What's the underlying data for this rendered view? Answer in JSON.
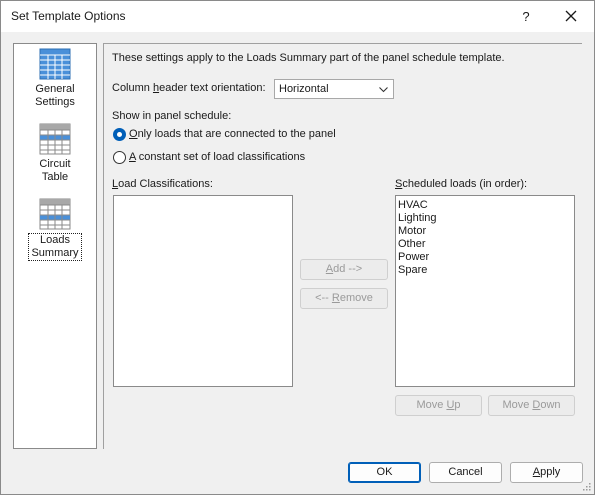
{
  "window": {
    "title": "Set Template Options",
    "help_label": "?",
    "close_icon": "close-icon"
  },
  "nav": {
    "items": [
      {
        "label_line1": "General",
        "label_line2": "Settings",
        "icon": "general-settings-table-icon",
        "selected": false
      },
      {
        "label_line1": "Circuit",
        "label_line2": "Table",
        "icon": "circuit-table-icon",
        "selected": false
      },
      {
        "label_line1": "Loads",
        "label_line2": "Summary",
        "icon": "loads-summary-table-icon",
        "selected": true
      }
    ]
  },
  "content": {
    "description": "These settings apply to the Loads Summary part of the panel schedule template.",
    "orientation_label": "Column header text orientation:",
    "orientation_value": "Horizontal",
    "show_label": "Show in panel schedule:",
    "radio_options": [
      {
        "label": "Only loads that are connected to the panel",
        "checked": true
      },
      {
        "label": "A constant set of load classifications",
        "checked": false
      }
    ],
    "load_classifications_label": "Load Classifications:",
    "load_classifications": [],
    "scheduled_loads_label": "Scheduled loads (in order):",
    "scheduled_loads": [
      "HVAC",
      "Lighting",
      "Motor",
      "Other",
      "Power",
      "Spare"
    ],
    "add_button": "Add -->",
    "remove_button": "<-- Remove",
    "move_up_button": "Move Up",
    "move_down_button": "Move Down"
  },
  "footer": {
    "ok_label": "OK",
    "cancel_label": "Cancel",
    "apply_label": "Apply"
  },
  "colors": {
    "accent": "#005fb8",
    "icon_blue": "#4a90d9",
    "icon_gray": "#a8a8a8"
  }
}
